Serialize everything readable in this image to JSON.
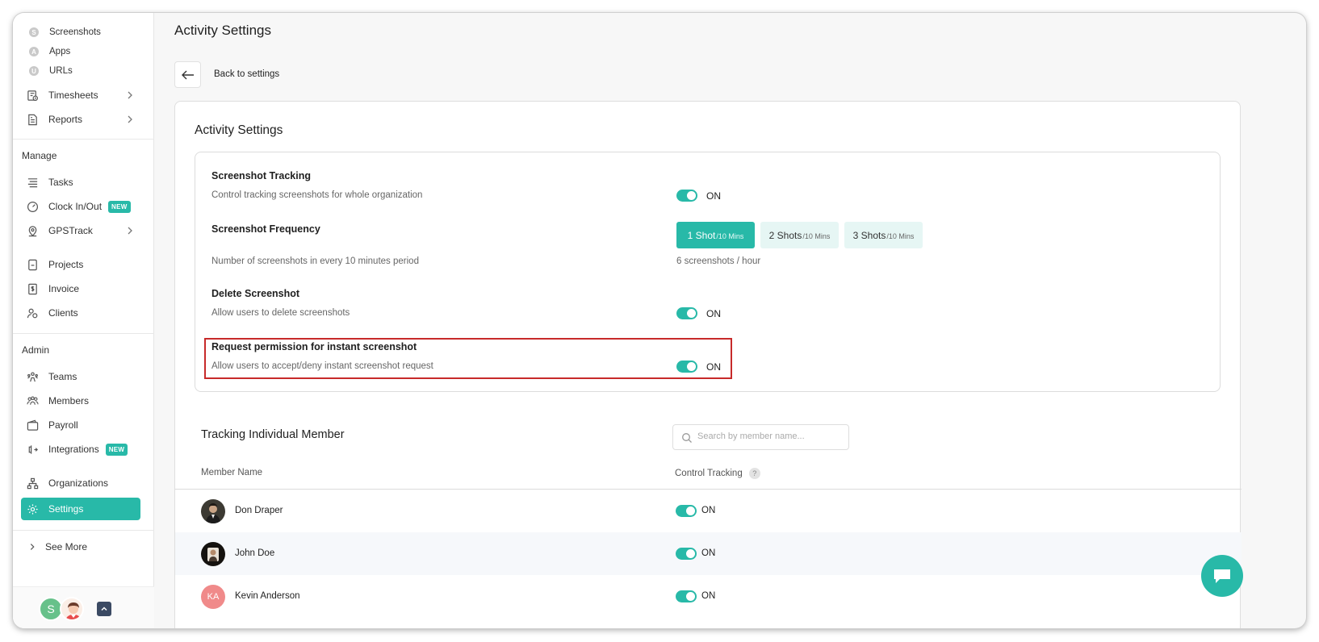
{
  "sidebar": {
    "sub_items": [
      "Screenshots",
      "Apps",
      "URLs"
    ],
    "sub_letters": [
      "S",
      "A",
      "U"
    ],
    "timesheets": "Timesheets",
    "reports": "Reports",
    "manage_label": "Manage",
    "tasks": "Tasks",
    "clock": "Clock In/Out",
    "clock_badge": "NEW",
    "gps": "GPSTrack",
    "projects": "Projects",
    "invoice": "Invoice",
    "clients": "Clients",
    "admin_label": "Admin",
    "teams": "Teams",
    "members": "Members",
    "payroll": "Payroll",
    "integrations": "Integrations",
    "integrations_badge": "NEW",
    "organizations": "Organizations",
    "settings": "Settings",
    "see_more": "See More",
    "user_initial": "S"
  },
  "header": {
    "title": "Activity Settings",
    "back_label": "Back to settings"
  },
  "card": {
    "title": "Activity Settings",
    "settings": {
      "screenshot_tracking": {
        "title": "Screenshot Tracking",
        "desc": "Control tracking screenshots for whole organization",
        "state": "ON"
      },
      "frequency": {
        "title": "Screenshot Frequency",
        "desc": "Number of screenshots in every 10 minutes period",
        "options": [
          {
            "main": "1 Shot",
            "sub": "/10 Mins"
          },
          {
            "main": "2 Shots",
            "sub": "/10 Mins"
          },
          {
            "main": "3 Shots",
            "sub": "/10 Mins"
          }
        ],
        "selected_index": 0,
        "rate_text": "6 screenshots / hour"
      },
      "delete": {
        "title": "Delete Screenshot",
        "desc": "Allow users to delete screenshots",
        "state": "ON"
      },
      "instant": {
        "title": "Request permission for instant screenshot",
        "desc": "Allow users to accept/deny instant screenshot request",
        "state": "ON"
      }
    }
  },
  "members_section": {
    "title": "Tracking Individual Member",
    "search_placeholder": "Search by member name...",
    "col_member": "Member Name",
    "col_control": "Control Tracking",
    "help": "?",
    "rows": [
      {
        "name": "Don Draper",
        "state": "ON",
        "initials": ""
      },
      {
        "name": "John Doe",
        "state": "ON",
        "initials": ""
      },
      {
        "name": "Kevin Anderson",
        "state": "ON",
        "initials": "KA"
      }
    ]
  },
  "colors": {
    "accent": "#28b9a8",
    "highlight": "#c72a2a"
  }
}
